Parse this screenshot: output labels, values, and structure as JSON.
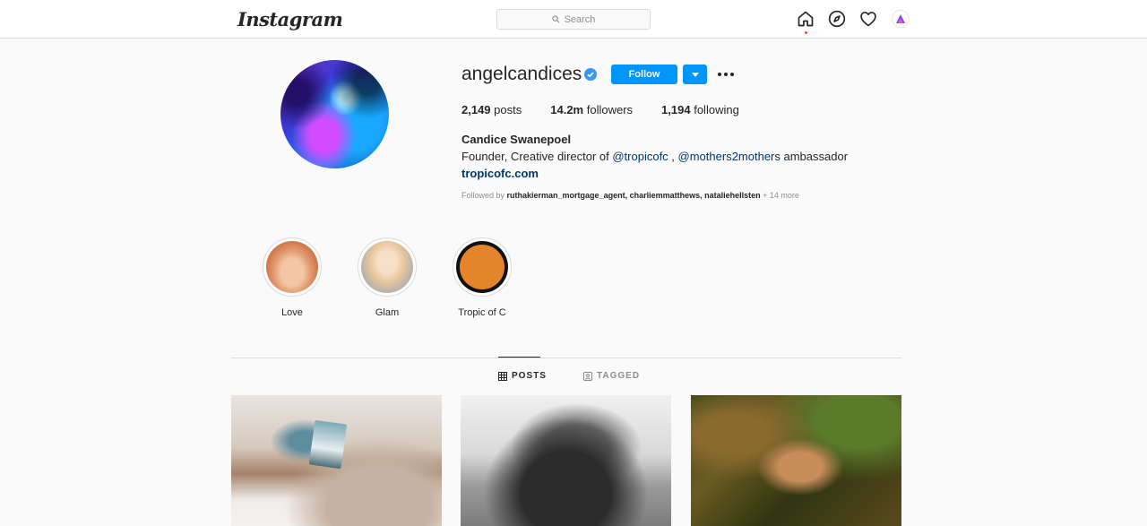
{
  "nav": {
    "logo": "Instagram",
    "search_placeholder": "Search"
  },
  "profile": {
    "username": "angelcandices",
    "follow_label": "Follow",
    "stats": {
      "posts_count": "2,149",
      "posts_label": "posts",
      "followers_count": "14.2m",
      "followers_label": "followers",
      "following_count": "1,194",
      "following_label": "following"
    },
    "full_name": "Candice Swanepoel",
    "bio_prefix": "Founder, Creative director of ",
    "bio_mention_1": "@tropicofc",
    "bio_separator": " , ",
    "bio_mention_2": "@mothers2mothers",
    "bio_suffix": " ambassador",
    "website": "tropicofc.com",
    "followed_by_prefix": "Followed by ",
    "followed_by_users": "ruthakierman_mortgage_agent, charliemmatthews, nataliehellsten",
    "followed_by_more": " + 14 more"
  },
  "highlights": [
    {
      "label": "Love"
    },
    {
      "label": "Glam"
    },
    {
      "label": "Tropic of C"
    }
  ],
  "tabs": {
    "posts": "POSTS",
    "tagged": "TAGGED"
  },
  "colors": {
    "accent": "#0095f6",
    "link": "#00376b",
    "notification": "#ed4956"
  }
}
